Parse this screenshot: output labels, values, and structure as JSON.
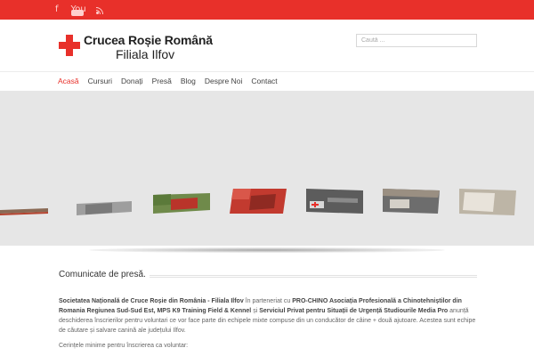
{
  "topbar": {
    "social": {
      "facebook": "f",
      "youtube": "You",
      "rss": "rss-icon"
    },
    "color": "#e8302a"
  },
  "header": {
    "title": "Crucea Roșie Română",
    "subtitle": "Filiala Ilfov",
    "search_placeholder": "Caută ..."
  },
  "nav": {
    "items": [
      {
        "label": "Acasă",
        "active": true
      },
      {
        "label": "Cursuri",
        "active": false
      },
      {
        "label": "Donați",
        "active": false
      },
      {
        "label": "Presă",
        "active": false
      },
      {
        "label": "Blog",
        "active": false
      },
      {
        "label": "Despre Noi",
        "active": false
      },
      {
        "label": "Contact",
        "active": false
      }
    ]
  },
  "section": {
    "title": "Comunicate de presă."
  },
  "article": {
    "p1_bold1": "Societatea Națională de Cruce Roșie din România - Filiala Ilfov",
    "p1_text1": " în parteneriat cu ",
    "p1_bold2": "PRO-CHINO Asociația Profesională a Chinotehniștilor din Romania Regiunea Sud-Sud Est, MPS K9 Training Field & Kennel",
    "p1_text2": " și ",
    "p1_bold3": "Serviciul Privat pentru Situații de Urgență Studiourile Media Pro",
    "p1_text3": " anunță deschiderea înscrierilor pentru voluntari ce vor face parte din echipele mixte compuse din un conducător de câine + două ajutoare. Acestea sunt echipe de căutare și salvare canină ale județului Ilfov.",
    "p2": "Cerințele minime pentru înscrierea ca voluntar:"
  }
}
